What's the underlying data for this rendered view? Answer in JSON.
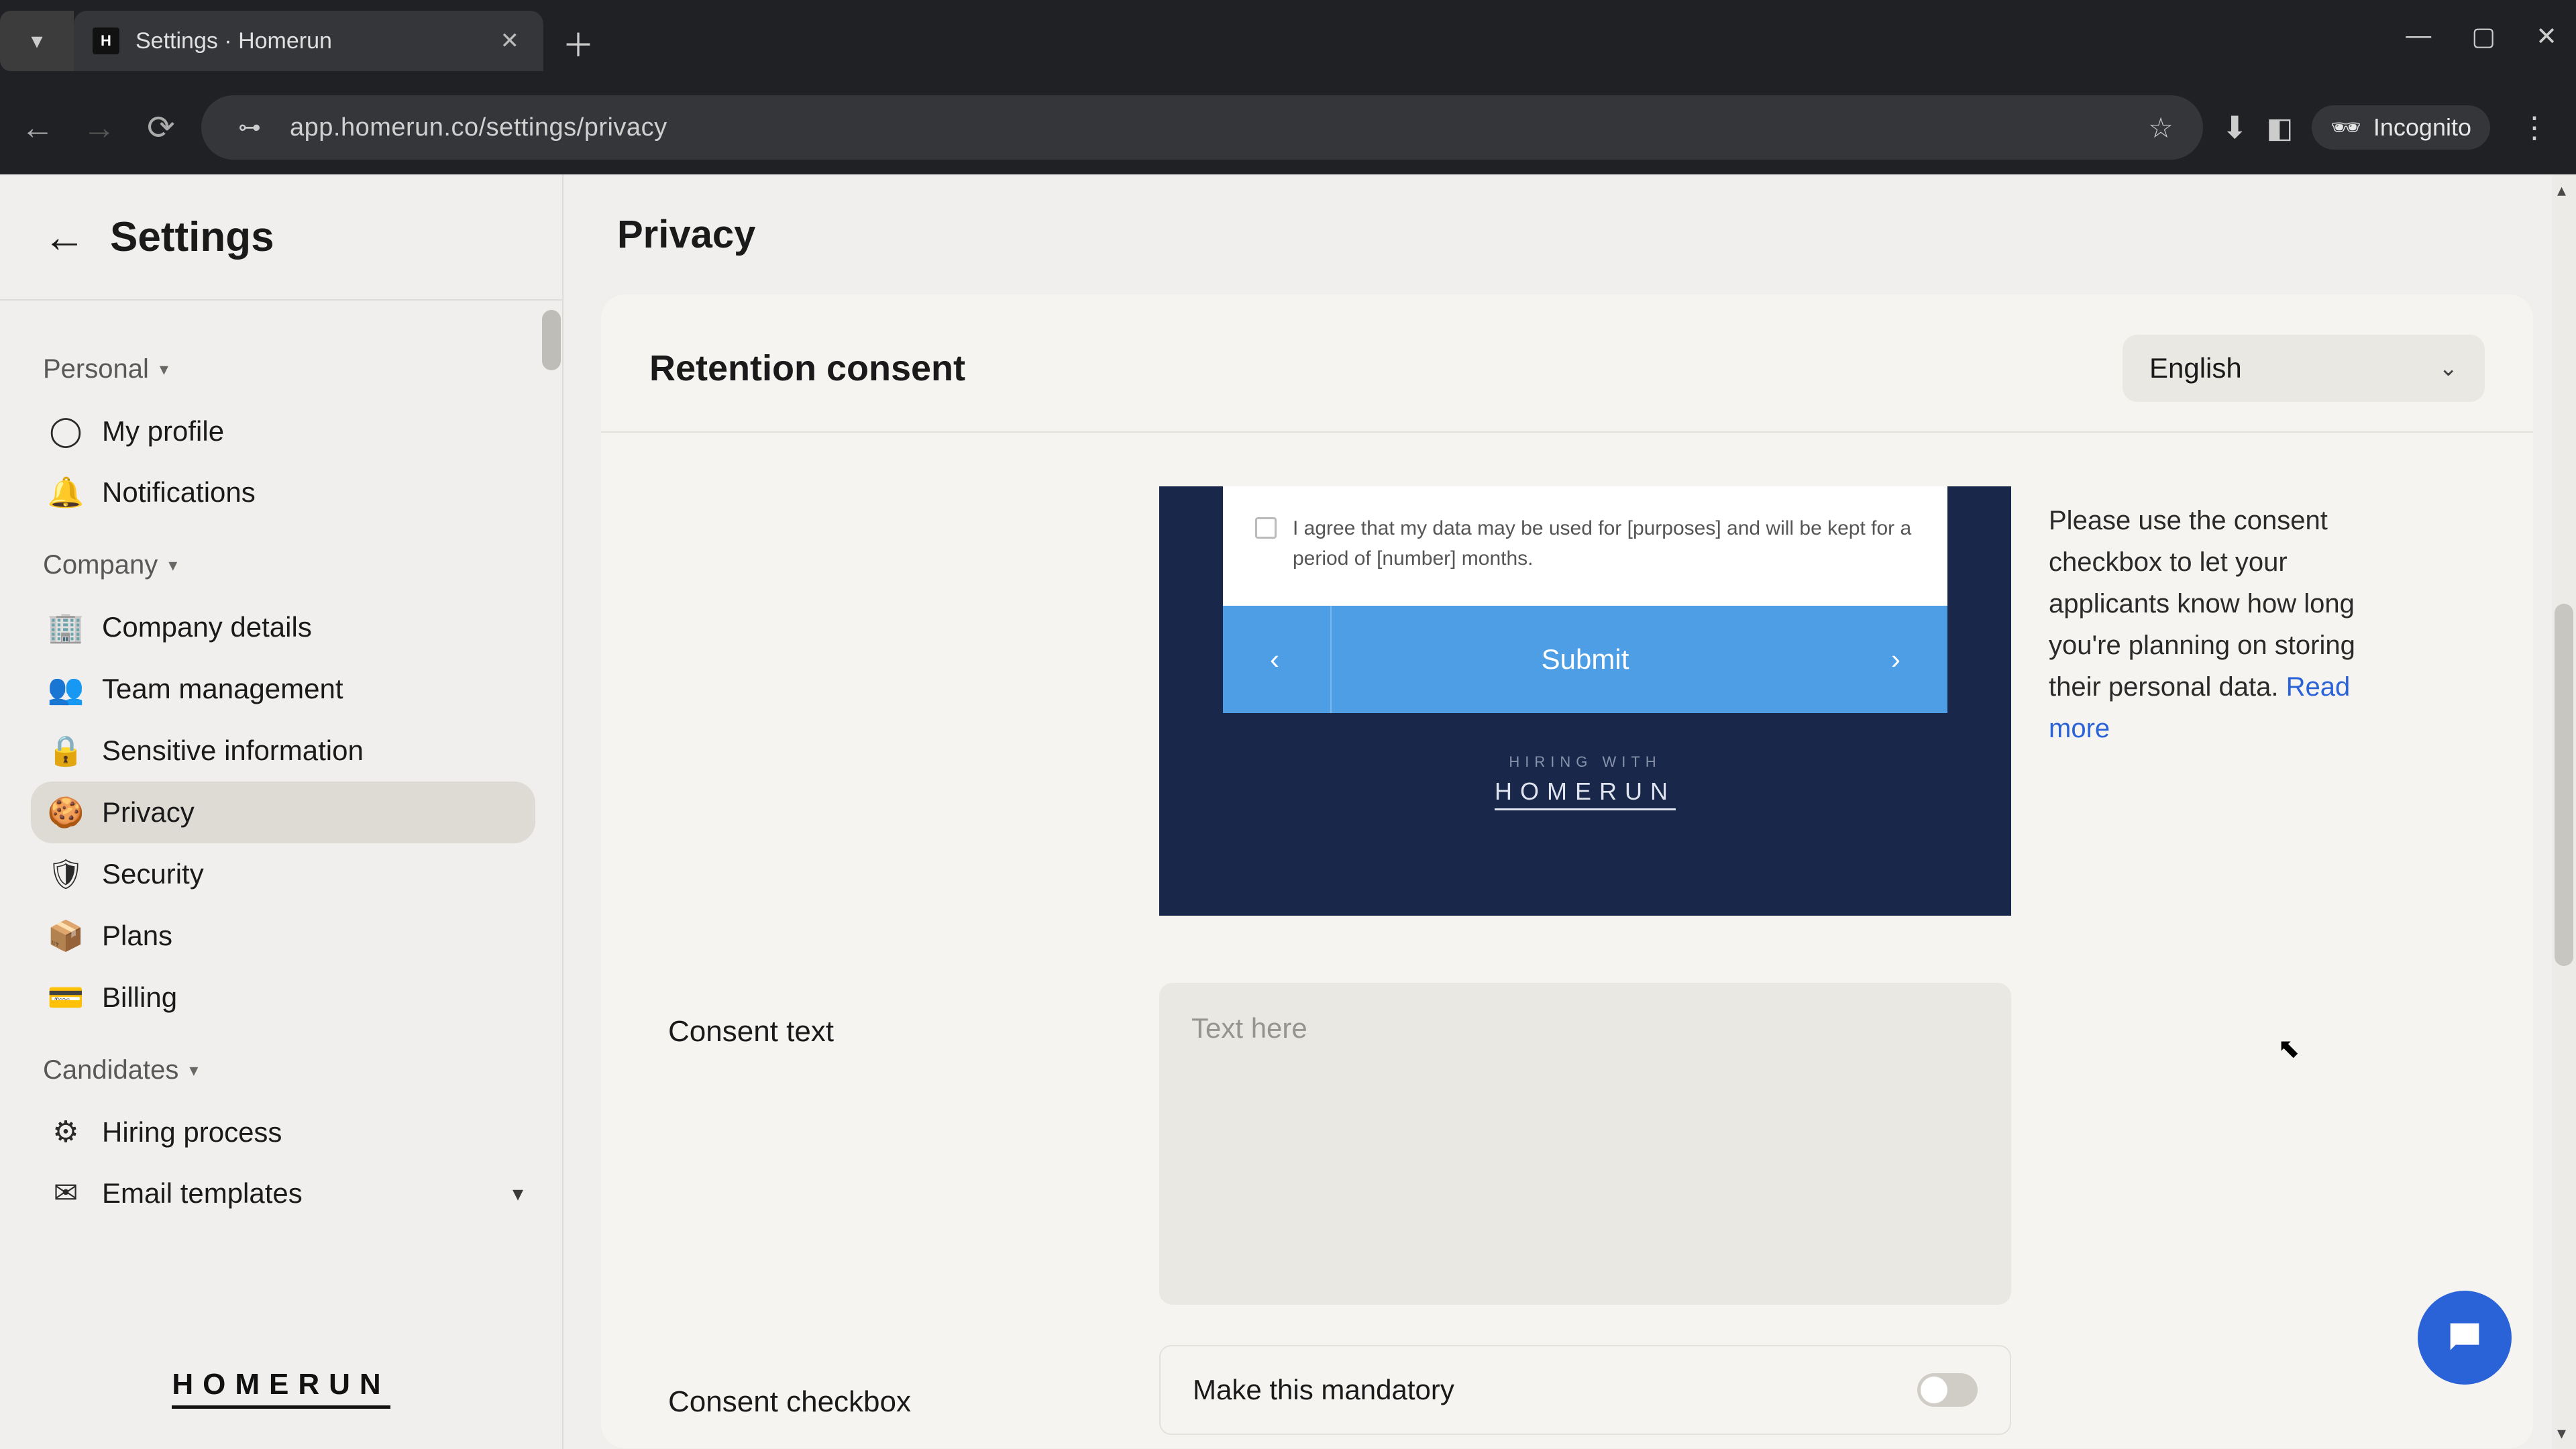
{
  "browser": {
    "tab_title": "Settings · Homerun",
    "url": "app.homerun.co/settings/privacy",
    "incognito_label": "Incognito"
  },
  "sidebar": {
    "header": "Settings",
    "sections": {
      "personal": {
        "label": "Personal"
      },
      "company": {
        "label": "Company"
      },
      "candidates": {
        "label": "Candidates"
      }
    },
    "items": {
      "my_profile": "My profile",
      "notifications": "Notifications",
      "company_details": "Company details",
      "team_management": "Team management",
      "sensitive_information": "Sensitive information",
      "privacy": "Privacy",
      "security": "Security",
      "plans": "Plans",
      "billing": "Billing",
      "hiring_process": "Hiring process",
      "email_templates": "Email templates"
    },
    "brand": "HOMERUN"
  },
  "main": {
    "title": "Privacy",
    "card": {
      "title": "Retention consent",
      "language_selected": "English",
      "preview": {
        "consent_text": "I agree that my data may be used for [purposes] and will be kept for a period of [number] months.",
        "submit_label": "Submit",
        "footer_tag": "HIRING WITH",
        "footer_brand": "HOMERUN"
      },
      "help_text": "Please use the consent checkbox to let your applicants know how long you're planning on storing their personal data.",
      "help_link": "Read more",
      "consent_text_label": "Consent text",
      "consent_text_placeholder": "Text here",
      "consent_checkbox_label": "Consent checkbox",
      "mandatory_label": "Make this mandatory"
    }
  }
}
